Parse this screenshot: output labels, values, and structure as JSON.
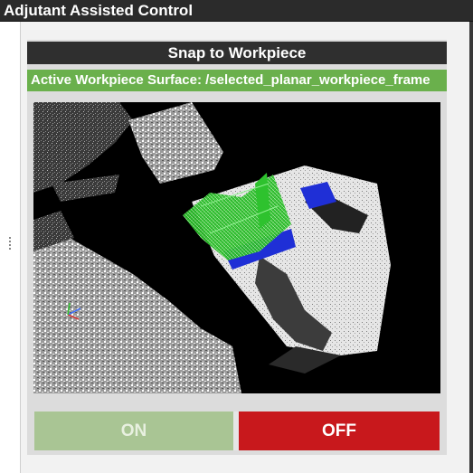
{
  "window": {
    "title": "Adjutant Assisted Control"
  },
  "panel": {
    "header": "Snap to Workpiece",
    "surface_label": "Active Workpiece Surface: /selected_planar_workpiece_frame"
  },
  "controls": {
    "on_label": "ON",
    "off_label": "OFF"
  },
  "colors": {
    "surface_bar": "#6ab04c",
    "on_button": "#a9c594",
    "off_button": "#c8181c",
    "header_bar": "#2f2f2f"
  }
}
